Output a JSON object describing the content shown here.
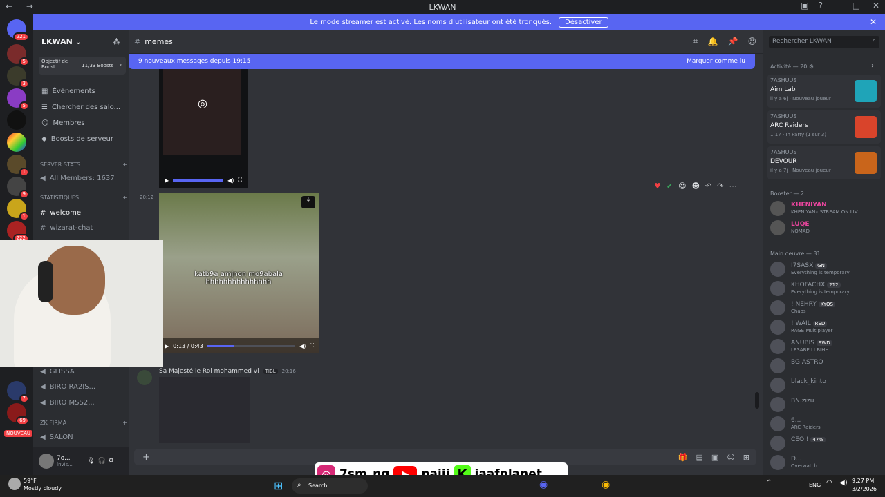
{
  "window": {
    "title": "LKWAN"
  },
  "banner": {
    "text": "Le mode streamer est activé. Les noms d'utilisateur ont été tronqués.",
    "button": "Désactiver"
  },
  "guilds": {
    "unread": "221",
    "badges": [
      "5",
      "3",
      "5",
      "1",
      "9",
      "1",
      "222",
      "2",
      "250",
      "7",
      "69"
    ],
    "new_label": "NOUVEAU"
  },
  "server": {
    "name": "LKWAN",
    "boost_goal": "Objectif de Boost",
    "boost_count": "11/33 Boosts",
    "nav": [
      "Événements",
      "Chercher des salo...",
      "Membres",
      "Boosts de serveur"
    ],
    "categories": {
      "stats": "SERVER STATS ...",
      "all_members": "All Members: 1637",
      "statistiques": "STATISTIQUES",
      "zk": "ZK FIRMA"
    },
    "channels": [
      "welcome",
      "wizarat-chat"
    ],
    "voice": [
      "GLISSA",
      "BIRO RA2IS...",
      "BIRO MSS2...",
      "SALON"
    ]
  },
  "user": {
    "name": "7o...",
    "status": "Invis..."
  },
  "channel": {
    "name": "memes",
    "new_messages": "9 nouveaux messages depuis 19:15",
    "mark_read": "Marquer comme lu",
    "time1": "20:12",
    "caption": "katb9a amjnon mo9abala hhhhhhhhhhhhhhh",
    "video_time": "0:13 / 0:43",
    "video_progress": 0.3,
    "author": "Sa Majesté le Roi mohammed vi",
    "author_tag": "TIBL",
    "time2": "20:16"
  },
  "members": {
    "search_placeholder": "Rechercher LKWAN",
    "activity_header": "Activité — 20",
    "activities": [
      {
        "server": "7ASHUUS",
        "game": "Aim Lab",
        "meta": "il y a 6j · Nouveau joueur",
        "color": "#1fa4b8"
      },
      {
        "server": "7ASHUUS",
        "game": "ARC Raiders",
        "meta": "1:17 · In Party (1 sur 3)",
        "color": "#d9442b"
      },
      {
        "server": "7ASHUUS",
        "game": "DEVOUR",
        "meta": "il y a 7j · Nouveau joueur",
        "color": "#c9651b"
      }
    ],
    "booster_header": "Booster — 2",
    "boosters": [
      {
        "name": "KHENIYAN",
        "status": "KHENIYANx STREAM ON LIV",
        "color": "#eb459e"
      },
      {
        "name": "LUQE",
        "tag": "ORBR",
        "status": "NOMAD",
        "color": "#eb459e"
      }
    ],
    "main_header": "Main oeuvre — 31",
    "main": [
      {
        "name": "I7SASX",
        "tag": "GN",
        "status": "Everything is temporary"
      },
      {
        "name": "KHOFACHX",
        "tag": "212",
        "status": "Everything is temporary"
      },
      {
        "name": "! NEHRY",
        "tag": "KYOS",
        "status": "Chaos"
      },
      {
        "name": "! WAIL",
        "tag": "RED",
        "status": "RAGE Multiplayer"
      },
      {
        "name": "ANUBIS",
        "tag": "9WD",
        "status": "LE3ABE LI BIHH"
      },
      {
        "name": "BG ASTRO",
        "status": ""
      },
      {
        "name": "black_kinto",
        "status": ""
      },
      {
        "name": "BN.zizu",
        "status": ""
      },
      {
        "name": "6...",
        "status": "ARC Raiders"
      },
      {
        "name": "CEO !",
        "tag": "47%",
        "status": ""
      },
      {
        "name": "D...",
        "status": "Overwatch"
      }
    ]
  },
  "composer": {
    "plus": "+"
  },
  "overlay": {
    "handles": [
      "7sm_ng",
      "najij",
      "jaafplanet"
    ]
  },
  "taskbar": {
    "weather_temp": "59°F",
    "weather_desc": "Mostly cloudy",
    "search": "Search",
    "lang": "ENG",
    "time": "9:27 PM",
    "date": "3/2/2026"
  }
}
